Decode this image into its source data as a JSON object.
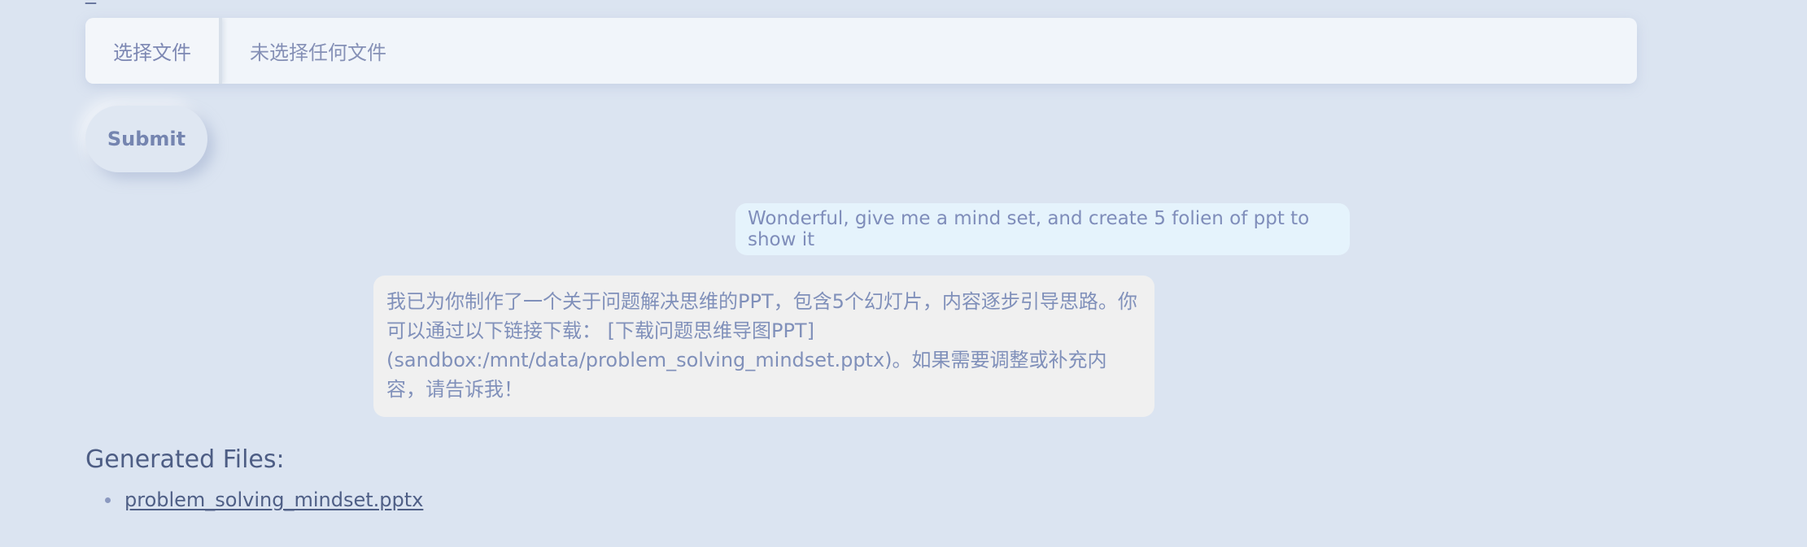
{
  "upload": {
    "choose_button_label": "选择文件",
    "file_status": "未选择任何文件"
  },
  "submit": {
    "label": "Submit"
  },
  "chat": {
    "user_message": "Wonderful, give me a mind set, and create 5 folien of ppt to show it",
    "assistant_message": "我已为你制作了一个关于问题解决思维的PPT，包含5个幻灯片，内容逐步引导思路。你可以通过以下链接下载： [下载问题思维导图PPT](sandbox:/mnt/data/problem_solving_mindset.pptx)。如果需要调整或补充内容，请告诉我！"
  },
  "generated_files": {
    "title": "Generated Files:",
    "items": [
      {
        "name": "problem_solving_mindset.pptx"
      }
    ]
  },
  "colors": {
    "background": "#dbe4f1",
    "file_input_background": "#f1f5fa",
    "user_bubble": "#e5f3fc",
    "assistant_bubble": "#f0f0f0",
    "text_muted": "#7c8ab4",
    "link": "#4f5f86"
  }
}
